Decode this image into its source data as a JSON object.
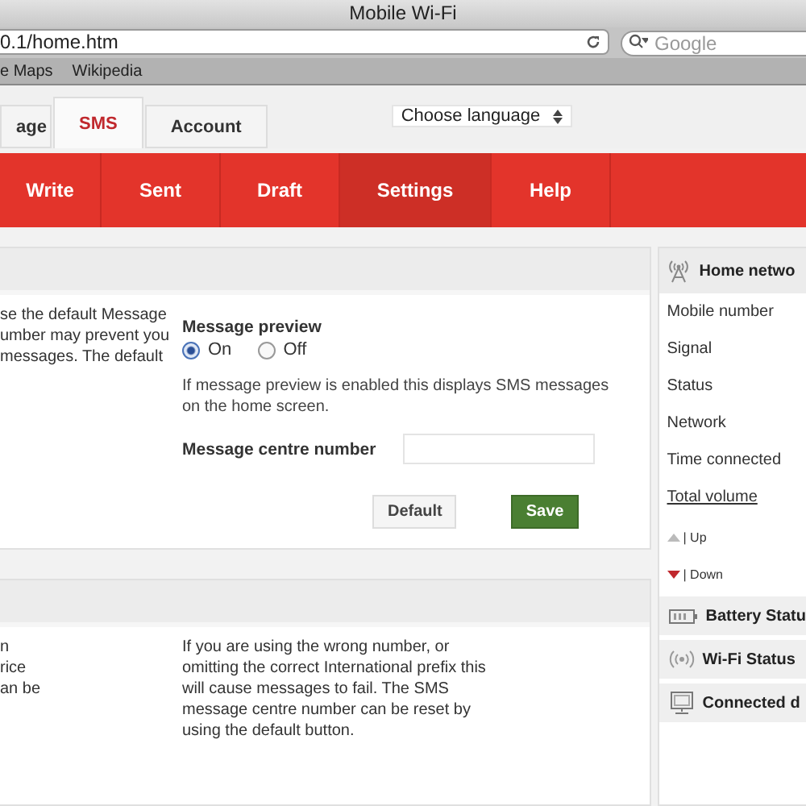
{
  "window": {
    "title": "Mobile Wi-Fi"
  },
  "browser": {
    "url": "0.1/home.htm",
    "search_placeholder": "Google",
    "bookmarks": [
      "e Maps",
      "Wikipedia"
    ]
  },
  "tabs": [
    {
      "label": "age",
      "selected": false
    },
    {
      "label": "SMS",
      "selected": true
    },
    {
      "label": "Account",
      "selected": false
    }
  ],
  "language_select": {
    "value": "Choose language"
  },
  "nav": [
    {
      "label": "Write",
      "selected": false
    },
    {
      "label": "Sent",
      "selected": false
    },
    {
      "label": "Draft",
      "selected": false
    },
    {
      "label": "Settings",
      "selected": true
    },
    {
      "label": "Help",
      "selected": false
    }
  ],
  "settings_panel": {
    "left_text": [
      "se the default Message",
      "umber may prevent you",
      "messages. The default"
    ],
    "preview_label": "Message preview",
    "preview_options": [
      {
        "label": "On",
        "selected": true
      },
      {
        "label": "Off",
        "selected": false
      }
    ],
    "preview_help": "If message preview is enabled this displays SMS messages on the home screen.",
    "centre_number_label": "Message centre number",
    "buttons": [
      {
        "label": "Default",
        "kind": "secondary"
      },
      {
        "label": "Save",
        "kind": "primary"
      }
    ]
  },
  "help_panel": {
    "left_text": [
      "n",
      "rice",
      "an be"
    ],
    "text": "If you are using the wrong number, or omitting the correct International prefix this will cause messages to fail. The SMS message centre number can be reset by using the default button."
  },
  "sidebar": {
    "header": "Home netwo",
    "rows": [
      {
        "label": "Mobile number",
        "kind": "plain"
      },
      {
        "label": "Signal",
        "kind": "plain"
      },
      {
        "label": "Status",
        "kind": "plain"
      },
      {
        "label": "Network",
        "kind": "plain"
      },
      {
        "label": "Time connected",
        "kind": "plain"
      },
      {
        "label": "Total volume",
        "kind": "link"
      },
      {
        "label": "| Up",
        "kind": "up"
      },
      {
        "label": "| Down",
        "kind": "down"
      }
    ],
    "sections": [
      {
        "label": "Battery Statu",
        "kind": "battery"
      },
      {
        "label": "Wi-Fi Status",
        "kind": "wifi"
      },
      {
        "label": "Connected d",
        "kind": "devices"
      }
    ]
  }
}
